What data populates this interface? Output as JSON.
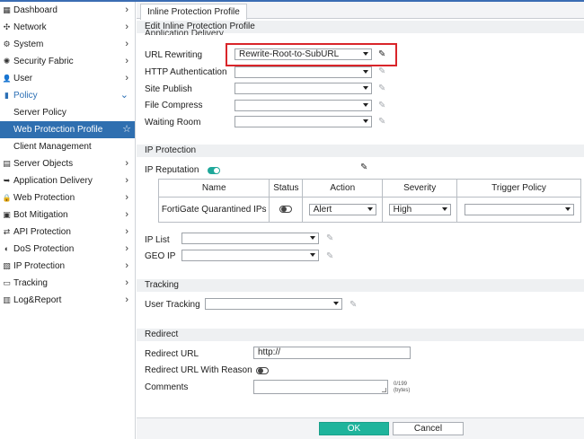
{
  "sidebar": {
    "items": [
      {
        "label": "Dashboard",
        "icon": "dashboard-icon",
        "glyph": "▦"
      },
      {
        "label": "Network",
        "icon": "network-icon",
        "glyph": "✣"
      },
      {
        "label": "System",
        "icon": "gear-icon",
        "glyph": "⚙"
      },
      {
        "label": "Security Fabric",
        "icon": "fabric-icon",
        "glyph": "✺"
      },
      {
        "label": "User",
        "icon": "user-icon",
        "glyph": "👤"
      },
      {
        "label": "Policy",
        "icon": "policy-icon",
        "glyph": "▮"
      },
      {
        "label": "Server Policy"
      },
      {
        "label": "Web Protection Profile"
      },
      {
        "label": "Client Management"
      },
      {
        "label": "Server Objects",
        "icon": "server-objects-icon",
        "glyph": "▤"
      },
      {
        "label": "Application Delivery",
        "icon": "app-delivery-icon",
        "glyph": "➥"
      },
      {
        "label": "Web Protection",
        "icon": "lock-icon",
        "glyph": "🔒"
      },
      {
        "label": "Bot Mitigation",
        "icon": "bot-icon",
        "glyph": "▣"
      },
      {
        "label": "API Protection",
        "icon": "api-icon",
        "glyph": "⇄"
      },
      {
        "label": "DoS Protection",
        "icon": "dos-icon",
        "glyph": "◐"
      },
      {
        "label": "IP Protection",
        "icon": "ip-icon",
        "glyph": "▧"
      },
      {
        "label": "Tracking",
        "icon": "tracking-icon",
        "glyph": "▭"
      },
      {
        "label": "Log&Report",
        "icon": "chart-icon",
        "glyph": "▥"
      }
    ]
  },
  "tab": {
    "label": "Inline Protection Profile"
  },
  "form": {
    "title": "Edit Inline Protection Profile",
    "clipped_section": "Application Delivery"
  },
  "app_delivery": {
    "url_rewriting": {
      "label": "URL Rewriting",
      "value": "Rewrite-Root-to-SubURL"
    },
    "http_auth": {
      "label": "HTTP Authentication",
      "value": ""
    },
    "site_publish": {
      "label": "Site Publish",
      "value": ""
    },
    "file_compress": {
      "label": "File Compress",
      "value": ""
    },
    "waiting_room": {
      "label": "Waiting Room",
      "value": ""
    }
  },
  "ip_protection": {
    "section_title": "IP Protection",
    "reputation_label": "IP Reputation",
    "reputation_enabled": true,
    "table": {
      "headers": {
        "name": "Name",
        "status": "Status",
        "action": "Action",
        "severity": "Severity",
        "trigger": "Trigger Policy"
      },
      "row": {
        "name": "FortiGate Quarantined IPs",
        "status_enabled": false,
        "action": "Alert",
        "severity": "High",
        "trigger": ""
      }
    },
    "ip_list": {
      "label": "IP List",
      "value": ""
    },
    "geo_ip": {
      "label": "GEO IP",
      "value": ""
    }
  },
  "tracking": {
    "section_title": "Tracking",
    "user_tracking": {
      "label": "User Tracking",
      "value": ""
    }
  },
  "redirect": {
    "section_title": "Redirect",
    "url": {
      "label": "Redirect URL",
      "value": "http://"
    },
    "with_reason": {
      "label": "Redirect URL With Reason",
      "enabled": false
    },
    "comments": {
      "label": "Comments",
      "value": "",
      "counter": "0/199",
      "unit": "(bytes)"
    }
  },
  "buttons": {
    "ok": "OK",
    "cancel": "Cancel"
  },
  "colors": {
    "accent": "#2f6fb0",
    "ok": "#1fb49c",
    "highlight": "#d9252a",
    "toggle_on": "#1fa89a"
  }
}
